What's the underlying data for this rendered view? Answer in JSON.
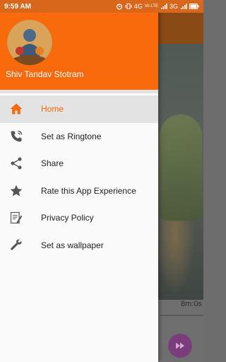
{
  "status_bar": {
    "time": "9:59 AM",
    "network": "4G",
    "volte": "Vo LTE",
    "network2": "3G"
  },
  "app": {
    "title": "Shiv Tandav Stotram",
    "duration": "8m:0s",
    "accent": "#f86a0b"
  },
  "menu": {
    "items": [
      {
        "label": "Home",
        "icon": "home-icon",
        "active": true
      },
      {
        "label": "Set as Ringtone",
        "icon": "phone-ring-icon",
        "active": false
      },
      {
        "label": "Share",
        "icon": "share-icon",
        "active": false
      },
      {
        "label": "Rate this App Experience",
        "icon": "star-icon",
        "active": false
      },
      {
        "label": "Privacy Policy",
        "icon": "document-edit-icon",
        "active": false
      },
      {
        "label": "Set as wallpaper",
        "icon": "wrench-icon",
        "active": false
      }
    ]
  }
}
